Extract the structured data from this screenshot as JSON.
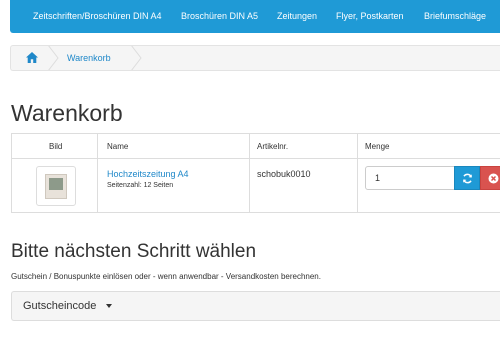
{
  "topnav": {
    "items": [
      "Zeitschriften/Broschüren DIN A4",
      "Broschüren DIN A5",
      "Zeitungen",
      "Flyer, Postkarten",
      "Briefumschläge"
    ]
  },
  "breadcrumb": {
    "home_icon": "home-icon",
    "current": "Warenkorb"
  },
  "page": {
    "title": "Warenkorb"
  },
  "cart": {
    "headers": [
      "Bild",
      "Name",
      "Artikelnr.",
      "Menge"
    ],
    "rows": [
      {
        "name": "Hochzeitszeitung A4",
        "meta": "Seitenzahl: 12 Seiten",
        "sku": "schobuk0010",
        "quantity": "1"
      }
    ],
    "refresh_icon": "refresh-icon",
    "remove_icon": "remove-icon"
  },
  "next_step": {
    "title": "Bitte nächsten Schritt wählen",
    "hint": "Gutschein / Bonuspunkte einlösen oder - wenn anwendbar - Versandkosten berechnen."
  },
  "coupon": {
    "label": "Gutscheincode"
  },
  "colors": {
    "brand": "#1f9ad6",
    "link": "#1f88c9",
    "danger": "#d9534f"
  }
}
